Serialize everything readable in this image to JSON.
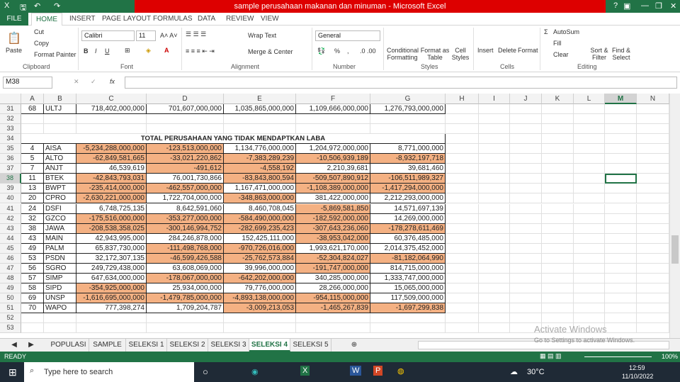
{
  "window": {
    "title": "sample perusahaan makanan dan minuman - Microsoft Excel",
    "help": "?",
    "min": "—",
    "restore": "❐",
    "close": "✕"
  },
  "ribbon_tabs": [
    "FILE",
    "HOME",
    "INSERT",
    "PAGE LAYOUT",
    "FORMULAS",
    "DATA",
    "REVIEW",
    "VIEW"
  ],
  "clipboard": {
    "paste": "Paste",
    "cut": "Cut",
    "copy": "Copy",
    "format_painter": "Format Painter",
    "label": "Clipboard"
  },
  "font": {
    "name": "Calibri",
    "size": "11",
    "label": "Font",
    "bold": "B",
    "italic": "I",
    "underline": "U"
  },
  "alignment": {
    "wrap": "Wrap Text",
    "merge": "Merge & Center",
    "label": "Alignment"
  },
  "number": {
    "format": "General",
    "percent": "%",
    "comma": ",",
    "label": "Number"
  },
  "styles": {
    "conditional": "Conditional Formatting",
    "format_table": "Format as Table",
    "cell_styles": "Cell Styles",
    "label": "Styles"
  },
  "cells": {
    "insert": "Insert",
    "delete": "Delete",
    "format": "Format",
    "label": "Cells"
  },
  "editing": {
    "autosum": "AutoSum",
    "fill": "Fill",
    "clear": "Clear",
    "sort": "Sort & Filter",
    "find": "Find & Select",
    "label": "Editing"
  },
  "formula_bar": {
    "name_box": "M38",
    "fx": "fx",
    "value": ""
  },
  "columns": [
    "A",
    "B",
    "C",
    "D",
    "E",
    "F",
    "G",
    "H",
    "I",
    "J",
    "K",
    "L",
    "M",
    "N"
  ],
  "selected_cell": "M38",
  "title_row": {
    "row": "34",
    "text": "TOTAL PERUSAHAAN YANG TIDAK MENDAPTKAN LABA"
  },
  "rows": [
    {
      "r": "31",
      "a": "68",
      "b": "ULTJ",
      "v": [
        "718,402,000,000",
        "701,607,000,000",
        "1,035,865,000,000",
        "1,109,666,000,000",
        "1,276,793,000,000"
      ]
    },
    {
      "r": "32",
      "empty": true
    },
    {
      "r": "33",
      "empty": true
    },
    {
      "r": "35",
      "a": "4",
      "b": "AISA",
      "v": [
        "-5,234,288,000,000",
        "-123,513,000,000",
        "1,134,776,000,000",
        "1,204,972,000,000",
        "8,771,000,000"
      ]
    },
    {
      "r": "36",
      "a": "5",
      "b": "ALTO",
      "v": [
        "-62,849,581,665",
        "-33,021,220,862",
        "-7,383,289,239",
        "-10,506,939,189",
        "-8,932,197,718"
      ]
    },
    {
      "r": "37",
      "a": "7",
      "b": "ANJT",
      "v": [
        "46,539,619",
        "-491,612",
        "-4,558,192",
        "2,210,39,681",
        "39,681,460"
      ]
    },
    {
      "r": "38",
      "a": "11",
      "b": "BTEK",
      "v": [
        "-42,843,793,031",
        "76,001,730,866",
        "-83,843,800,594",
        "-509,507,890,912",
        "-106,511,989,327"
      ]
    },
    {
      "r": "39",
      "a": "13",
      "b": "BWPT",
      "v": [
        "-235,414,000,000",
        "-462,557,000,000",
        "1,167,471,000,000",
        "-1,108,389,000,000",
        "-1,417,294,000,000"
      ]
    },
    {
      "r": "40",
      "a": "20",
      "b": "CPRO",
      "v": [
        "-2,630,221,000,000",
        "1,722,704,000,000",
        "-348,863,000,000",
        "381,422,000,000",
        "2,212,293,000,000"
      ]
    },
    {
      "r": "41",
      "a": "24",
      "b": "DSFI",
      "v": [
        "6,748,725,135",
        "8,642,591,060",
        "8,460,708,045",
        "-5,869,581,850",
        "14,571,697,139"
      ]
    },
    {
      "r": "42",
      "a": "32",
      "b": "GZCO",
      "v": [
        "-175,516,000,000",
        "-353,277,000,000",
        "-584,490,000,000",
        "-182,592,000,000",
        "14,269,000,000"
      ]
    },
    {
      "r": "43",
      "a": "38",
      "b": "JAWA",
      "v": [
        "-208,538,358,025",
        "-300,146,994,752",
        "-282,699,235,423",
        "-307,643,236,060",
        "-178,278,611,469"
      ]
    },
    {
      "r": "44",
      "a": "43",
      "b": "MAIN",
      "v": [
        "42,943,995,000",
        "284,246,878,000",
        "152,425,111,000",
        "-38,953,042,000",
        "60,376,485,000"
      ]
    },
    {
      "r": "45",
      "a": "49",
      "b": "PALM",
      "v": [
        "65,837,730,000",
        "-111,498,768,000",
        "-970,726,016,000",
        "1,993,621,170,000",
        "2,014,375,452,000"
      ]
    },
    {
      "r": "46",
      "a": "53",
      "b": "PSDN",
      "v": [
        "32,172,307,135",
        "-46,599,426,588",
        "-25,762,573,884",
        "-52,304,824,027",
        "-81,182,064,990"
      ]
    },
    {
      "r": "47",
      "a": "56",
      "b": "SGRO",
      "v": [
        "249,729,438,000",
        "63,608,069,000",
        "39,996,000,000",
        "-191,747,000,000",
        "814,715,000,000"
      ]
    },
    {
      "r": "48",
      "a": "57",
      "b": "SIMP",
      "v": [
        "647,634,000,000",
        "-178,067,000,000",
        "-642,202,000,000",
        "340,285,000,000",
        "1,333,747,000,000"
      ]
    },
    {
      "r": "49",
      "a": "58",
      "b": "SIPD",
      "v": [
        "-354,925,000,000",
        "25,934,000,000",
        "79,776,000,000",
        "28,266,000,000",
        "15,065,000,000"
      ]
    },
    {
      "r": "50",
      "a": "69",
      "b": "UNSP",
      "v": [
        "-1,616,695,000,000",
        "-1,479,785,000,000",
        "-4,893,138,000,000",
        "-954,115,000,000",
        "117,509,000,000"
      ]
    },
    {
      "r": "51",
      "a": "70",
      "b": "WAPO",
      "v": [
        "777,398,274",
        "1,709,204,787",
        "-3,009,213,053",
        "-1,465,267,839",
        "-1,697,299,838"
      ]
    },
    {
      "r": "52",
      "empty": true
    },
    {
      "r": "53",
      "empty": true
    }
  ],
  "sheet_tabs": [
    "POPULASI",
    "SAMPLE",
    "SELEKSI 1",
    "SELEKSI 2",
    "SELEKSI 3",
    "SELEKSI 4",
    "SELEKSI 5"
  ],
  "active_sheet": "SELEKSI 4",
  "status": {
    "ready": "READY",
    "zoom": "100%"
  },
  "watermark": {
    "title": "Activate Windows",
    "sub": "Go to Settings to activate Windows."
  },
  "taskbar": {
    "search": "Type here to search",
    "temp": "30°C",
    "time": "12:59",
    "date": "11/10/2022"
  },
  "colors": {
    "excel_green": "#217346",
    "negative_fill": "#f4b183"
  }
}
